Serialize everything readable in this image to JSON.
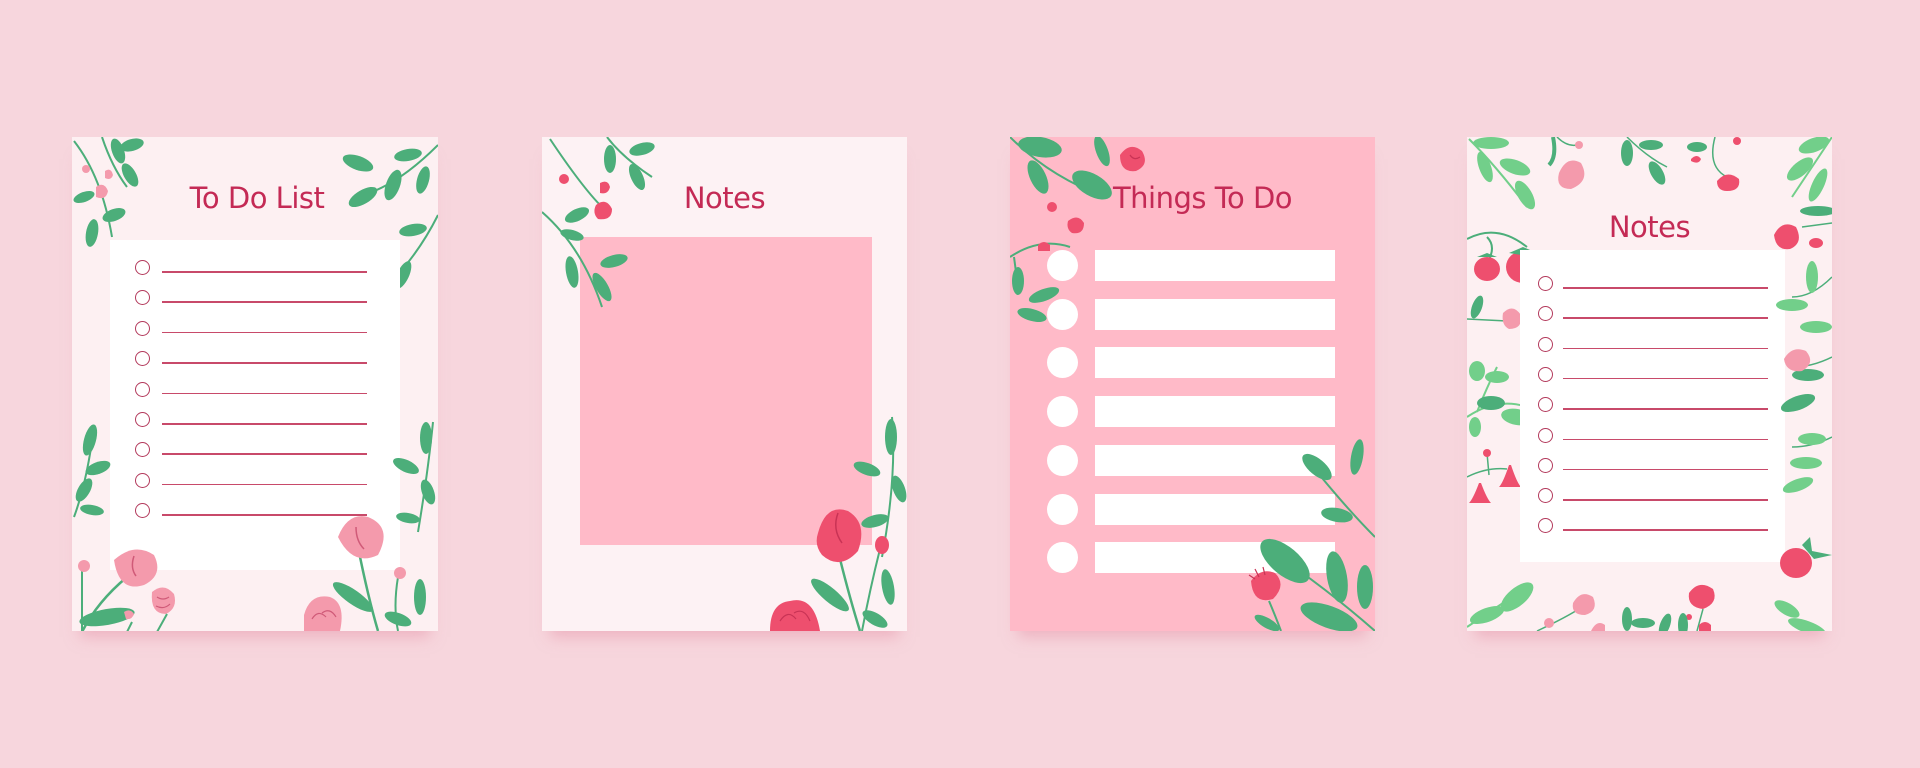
{
  "page": {
    "background": "#f7d6dd",
    "colors": {
      "title": "#c42a55",
      "rule_line": "#c84a6a",
      "checkbox": "#b33a5c",
      "leaf_dark": "#4cae7a",
      "leaf_light": "#72cf8a",
      "flower_pink": "#f49aac",
      "flower_red": "#ee4f6e",
      "card_pink": "#ffbac8"
    }
  },
  "cards": [
    {
      "title": "To Do List",
      "style": "checklist",
      "rows": 9,
      "decorations": [
        "leaf-sprig-icon",
        "tulip-icon",
        "rose-icon",
        "bud-icon"
      ]
    },
    {
      "title": "Notes",
      "style": "blank-pink-block",
      "decorations": [
        "leaf-sprig-icon",
        "tulip-icon",
        "rose-icon",
        "bud-icon"
      ]
    },
    {
      "title": "Things To Do",
      "style": "bullet-bars",
      "rows": 7,
      "decorations": [
        "leaf-sprig-icon",
        "tulip-icon",
        "bud-icon"
      ]
    },
    {
      "title": "Notes",
      "style": "checklist",
      "rows": 9,
      "decorations": [
        "leaf-sprig-icon",
        "raspberry-icon",
        "tulip-icon",
        "bellflower-icon",
        "rose-icon"
      ]
    }
  ]
}
